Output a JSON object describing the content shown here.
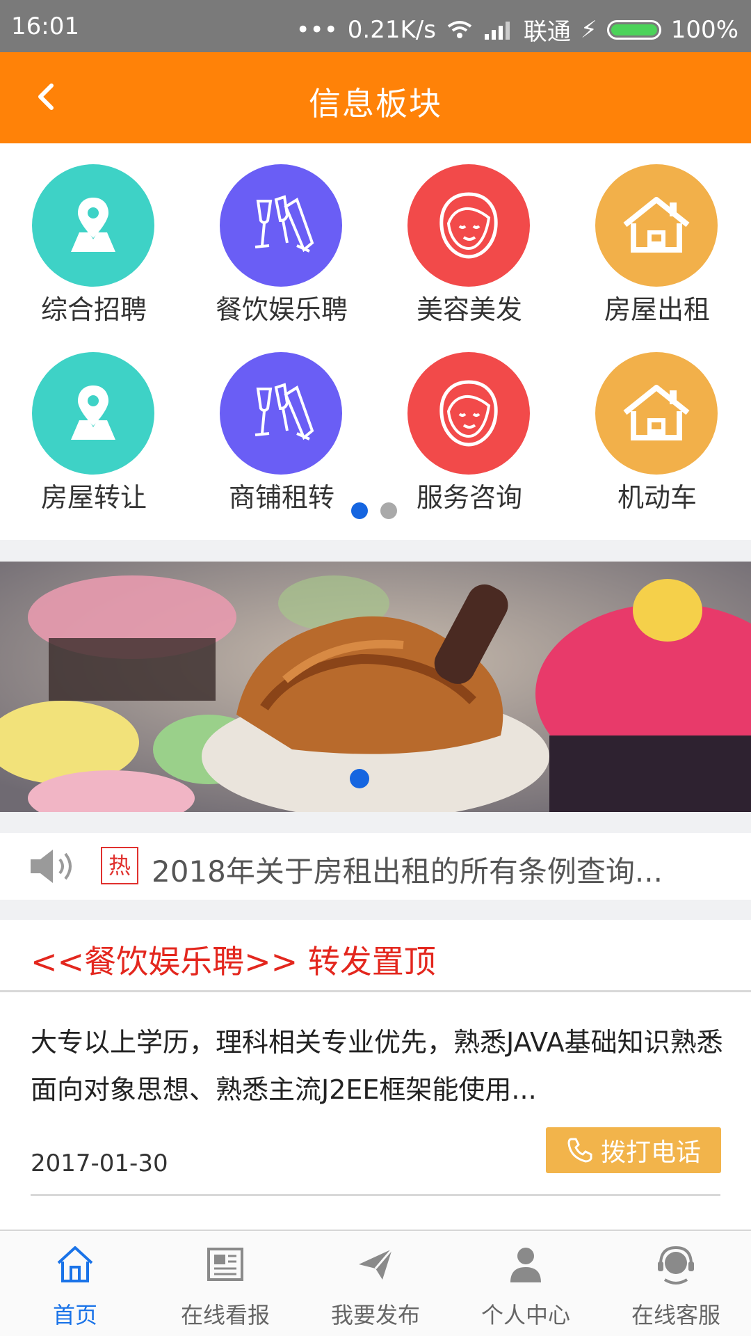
{
  "status_bar": {
    "time": "16:01",
    "network_speed": "0.21K/s",
    "carrier": "联通",
    "battery": "100%"
  },
  "header": {
    "title": "信息板块"
  },
  "categories": [
    {
      "label": "综合招聘",
      "icon": "map-pin-icon",
      "color": "#3ed2c6"
    },
    {
      "label": "餐饮娱乐聘",
      "icon": "champagne-icon",
      "color": "#6a5ef5"
    },
    {
      "label": "美容美发",
      "icon": "face-icon",
      "color": "#f24a4a"
    },
    {
      "label": "房屋出租",
      "icon": "house-icon",
      "color": "#f2b04a"
    },
    {
      "label": "房屋转让",
      "icon": "map-pin-icon",
      "color": "#3ed2c6"
    },
    {
      "label": "商铺租转",
      "icon": "champagne-icon",
      "color": "#6a5ef5"
    },
    {
      "label": "服务咨询",
      "icon": "face-icon",
      "color": "#f24a4a"
    },
    {
      "label": "机动车",
      "icon": "house-icon",
      "color": "#f2b04a"
    }
  ],
  "notice": {
    "hot_tag": "热",
    "text": "2018年关于房租出租的所有条例查询..."
  },
  "post": {
    "heading": "<<餐饮娱乐聘>> 转发置顶",
    "body": "大专以上学历，理科相关专业优先，熟悉JAVA基础知识熟悉面向对象思想、熟悉主流J2EE框架能使用...",
    "date": "2017-01-30",
    "call_label": "拨打电话"
  },
  "tabs": [
    {
      "label": "首页",
      "icon": "home-icon"
    },
    {
      "label": "在线看报",
      "icon": "newspaper-icon"
    },
    {
      "label": "我要发布",
      "icon": "paper-plane-icon"
    },
    {
      "label": "个人中心",
      "icon": "person-icon"
    },
    {
      "label": "在线客服",
      "icon": "headset-icon"
    }
  ],
  "colors": {
    "accent": "#ff8208",
    "active_tab": "#1a73e8",
    "hot_red": "#e3271e",
    "call_button": "#f2b44b"
  }
}
